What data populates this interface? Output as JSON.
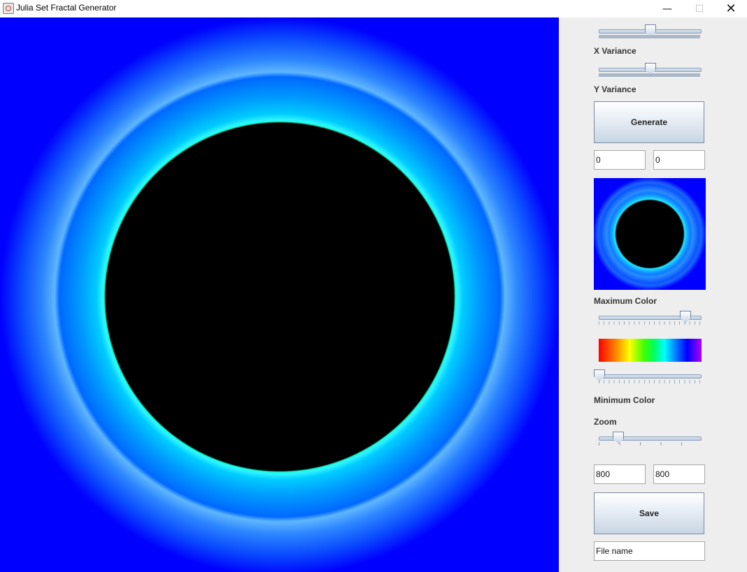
{
  "window": {
    "title": "Julia Set Fractal Generator"
  },
  "controls": {
    "x_variance": {
      "label": "X Variance",
      "value": 0.5
    },
    "y_variance": {
      "label": "Y Variance",
      "value": 0.5
    },
    "generate_label": "Generate",
    "coords": {
      "x": "0",
      "y": "0"
    },
    "max_color": {
      "label": "Maximum Color",
      "value": 0.85
    },
    "min_color": {
      "label": "Minimum Color",
      "value": 0.0
    },
    "zoom": {
      "label": "Zoom",
      "value": 0.2
    },
    "size": {
      "width": "800",
      "height": "800"
    },
    "save_label": "Save",
    "filename": {
      "value": "File name"
    }
  },
  "colors": {
    "background": "#0000ff",
    "set_interior": "#000000",
    "edge": "#19ffd9"
  }
}
